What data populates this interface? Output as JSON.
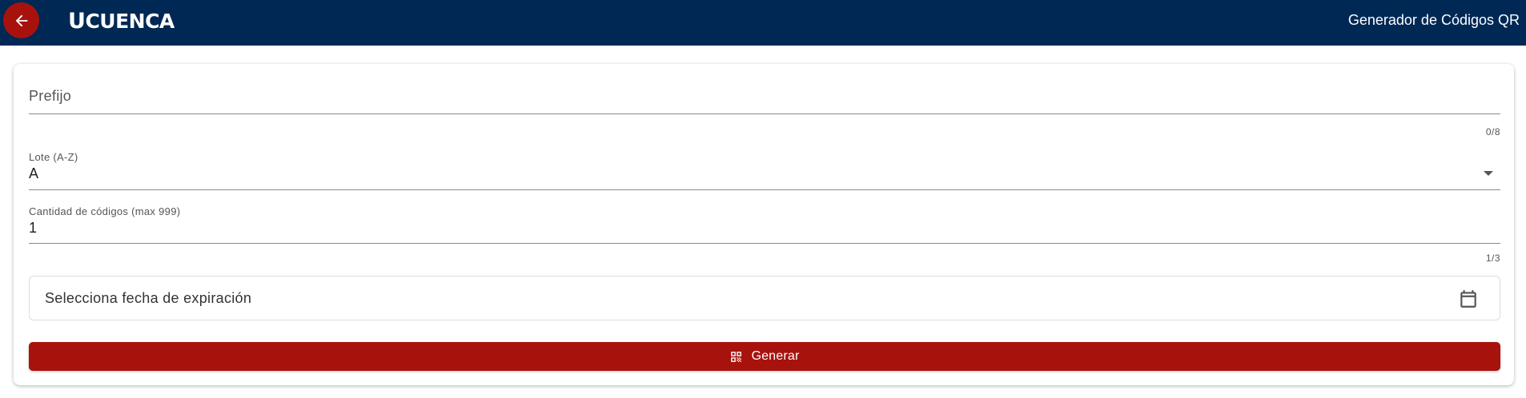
{
  "header": {
    "back_icon": "arrow-left-icon",
    "brand_first": "U",
    "brand_rest": "CUENCA",
    "title": "Generador de Códigos QR",
    "bg_color": "#002855",
    "back_color": "#a8120d"
  },
  "form": {
    "prefix": {
      "label": "Prefijo",
      "value": "",
      "counter": "0/8"
    },
    "batch": {
      "label": "Lote (A-Z)",
      "value": "A",
      "dropdown_icon": "caret-down-icon"
    },
    "quantity": {
      "label": "Cantidad de códigos (max 999)",
      "value": "1",
      "counter": "1/3"
    },
    "expiry": {
      "placeholder": "Selecciona fecha de expiración",
      "icon": "calendar-icon"
    },
    "generate": {
      "label": "Generar",
      "icon": "qr-code-icon",
      "color": "#a8120d"
    }
  }
}
